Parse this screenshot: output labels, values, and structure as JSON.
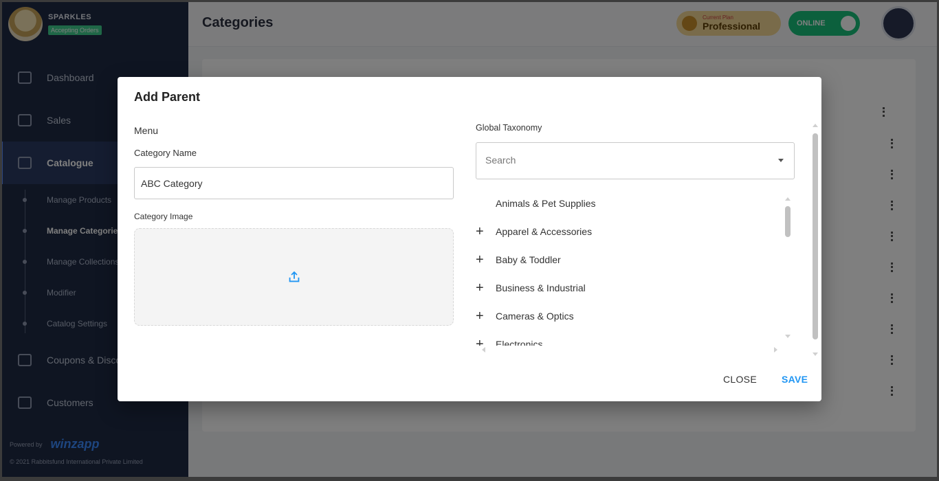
{
  "app": {
    "store_name": "SPARKLES",
    "store_status": "Accepting Orders",
    "sidebar": {
      "items": [
        {
          "label": "Dashboard",
          "icon": "grid-icon"
        },
        {
          "label": "Sales",
          "icon": "chart-icon"
        },
        {
          "label": "Catalogue",
          "icon": "catalogue-icon",
          "active": true
        },
        {
          "label": "Coupons & Discounts",
          "icon": "coupon-icon"
        },
        {
          "label": "Customers",
          "icon": "customers-icon"
        }
      ],
      "subitems": [
        {
          "label": "Manage Products"
        },
        {
          "label": "Manage Categories",
          "active": true
        },
        {
          "label": "Manage Collections"
        },
        {
          "label": "Modifier"
        },
        {
          "label": "Catalog Settings"
        }
      ],
      "powered_by": "Powered by",
      "powered_brand": "winzapp",
      "copyright": "© 2021 Rabbitsfund International Private Limited"
    },
    "topbar": {
      "title": "Categories",
      "plan_label": "Current Plan",
      "plan_name": "Professional",
      "online_label": "ONLINE"
    }
  },
  "modal": {
    "title": "Add Parent",
    "menu_label": "Menu",
    "category_name_label": "Category Name",
    "category_name_value": "ABC Category",
    "category_image_label": "Category Image",
    "taxonomy_label": "Global Taxonomy",
    "search_placeholder": "Search",
    "taxonomy": [
      {
        "label": "Animals & Pet Supplies",
        "expandable": false
      },
      {
        "label": "Apparel & Accessories",
        "expandable": true
      },
      {
        "label": "Baby & Toddler",
        "expandable": true
      },
      {
        "label": "Business & Industrial",
        "expandable": true
      },
      {
        "label": "Cameras & Optics",
        "expandable": true
      },
      {
        "label": "Electronics",
        "expandable": true
      }
    ],
    "close_label": "CLOSE",
    "save_label": "SAVE"
  },
  "colors": {
    "accent": "#2196f3",
    "sidebar_bg": "#1f2a44",
    "online": "#19c07b"
  }
}
